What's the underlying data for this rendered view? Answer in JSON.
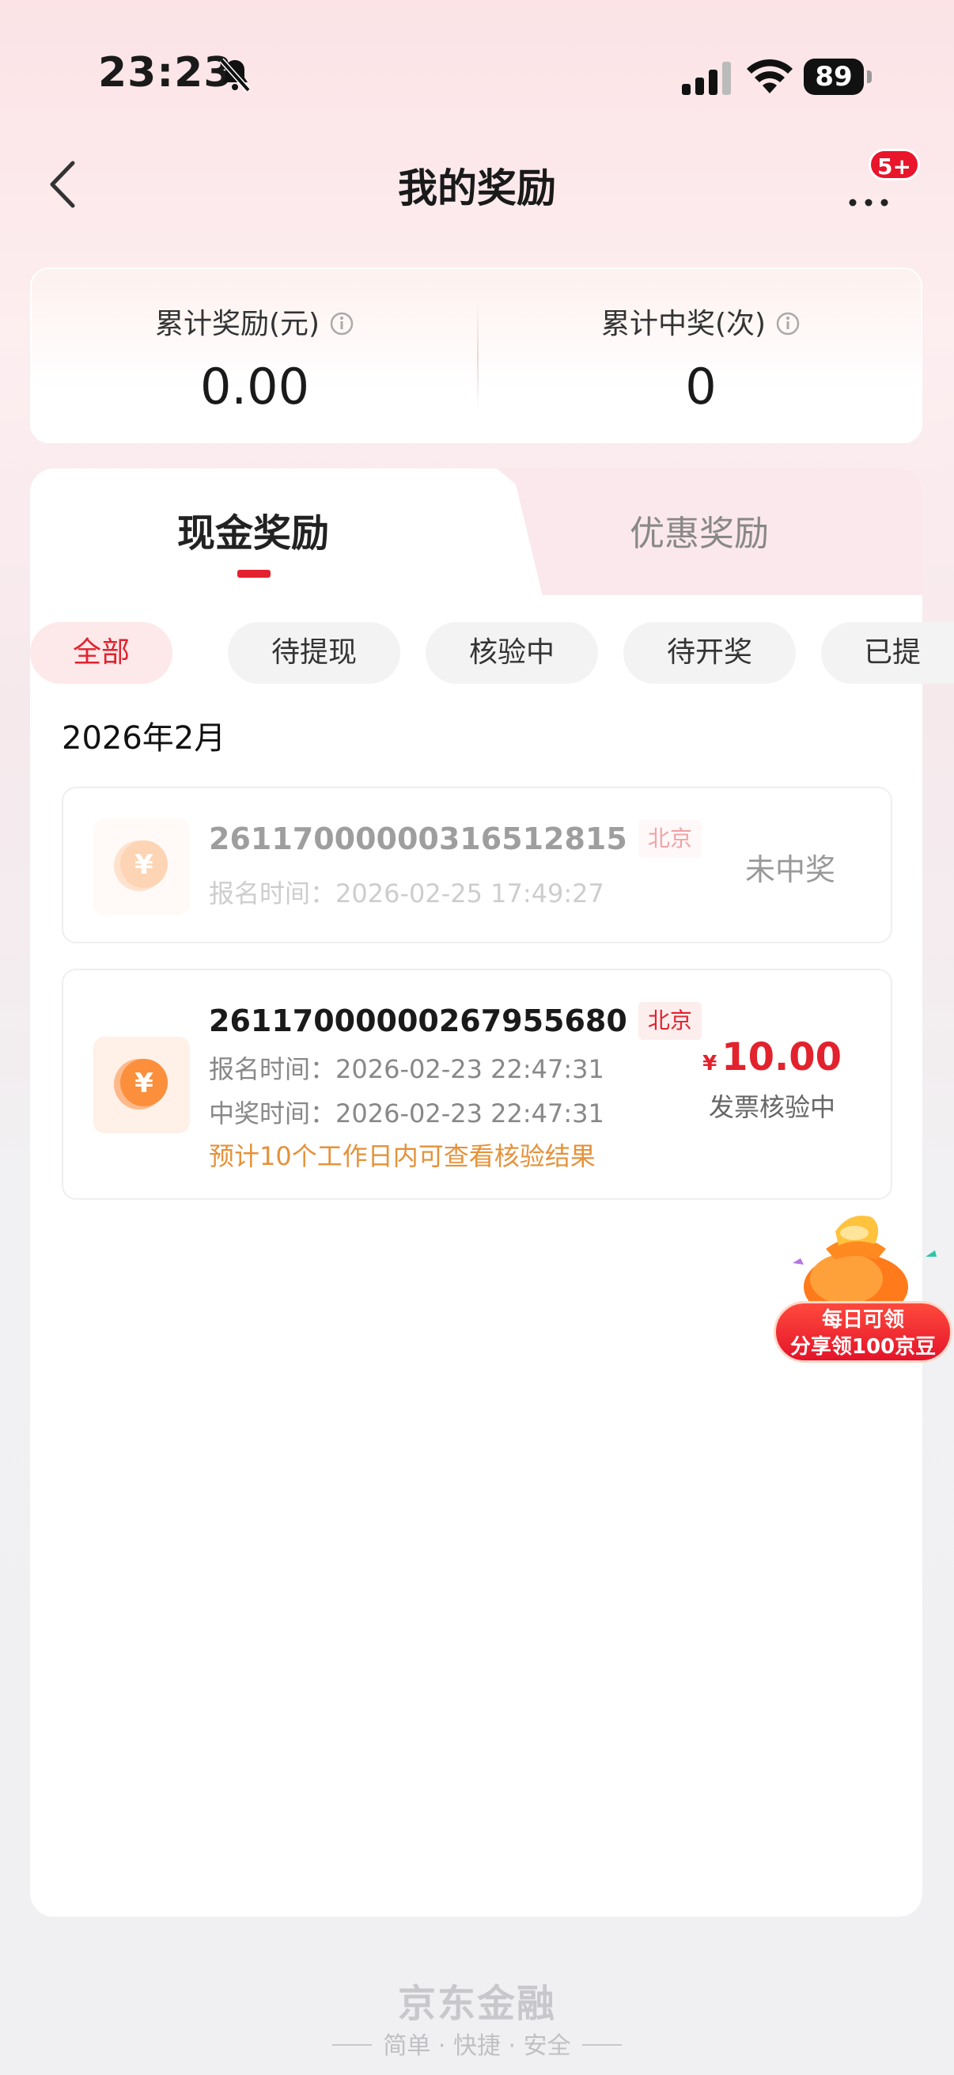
{
  "status_bar": {
    "time": "23:23",
    "battery": "89"
  },
  "header": {
    "title": "我的奖励",
    "more_badge": "5+"
  },
  "stats": [
    {
      "label": "累计奖励(元)",
      "value": "0.00"
    },
    {
      "label": "累计中奖(次)",
      "value": "0"
    }
  ],
  "tabs": [
    {
      "label": "现金奖励"
    },
    {
      "label": "优惠奖励"
    }
  ],
  "filters": [
    {
      "label": "全部",
      "active": true
    },
    {
      "label": "待提现"
    },
    {
      "label": "核验中"
    },
    {
      "label": "待开奖"
    },
    {
      "label": "已提"
    }
  ],
  "month": "2026年2月",
  "records": [
    {
      "id": "26117000000316512815",
      "city": "北京",
      "signup": "报名时间：2026-02-25 17:49:27",
      "status": "未中奖"
    },
    {
      "id": "26117000000267955680",
      "city": "北京",
      "signup": "报名时间：2026-02-23 22:47:31",
      "won": "中奖时间：2026-02-23 22:47:31",
      "note": "预计10个工作日内可查看核验结果",
      "currency": "¥",
      "amount": "10.00",
      "status": "发票核验中"
    }
  ],
  "promo": {
    "line1": "每日可领",
    "line2": "分享领100京豆"
  },
  "footer": {
    "brand": "京东金融",
    "tagline": "简单 · 快捷 · 安全"
  },
  "colors": {
    "accent": "#e2222d",
    "note": "#e5923a"
  }
}
